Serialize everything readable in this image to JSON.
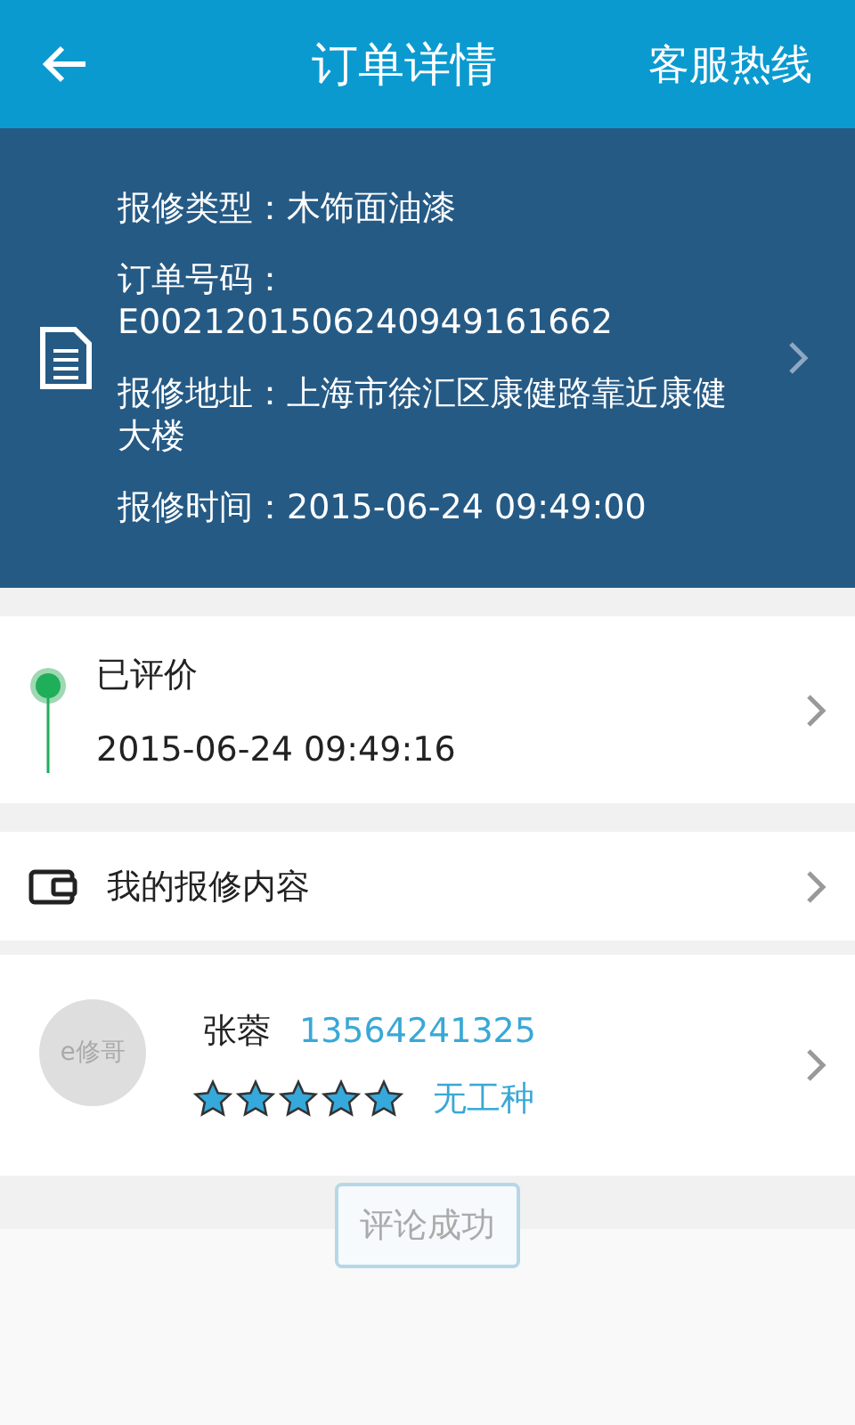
{
  "header": {
    "title": "订单详情",
    "action": "客服热线"
  },
  "order": {
    "lines": [
      "报修类型：木饰面油漆",
      "订单号码：E0021201506240949161662",
      "报修地址：上海市徐汇区康健路靠近康健大楼",
      "报修时间：2015-06-24 09:49:00"
    ]
  },
  "status": {
    "label": "已评价",
    "time": "2015-06-24 09:49:16"
  },
  "content_row": {
    "label": "我的报修内容"
  },
  "worker": {
    "avatar_text": "e修哥",
    "name": "张蓉",
    "phone": "13564241325",
    "stars": 5,
    "trade": "无工种"
  },
  "toast": "评论成功"
}
